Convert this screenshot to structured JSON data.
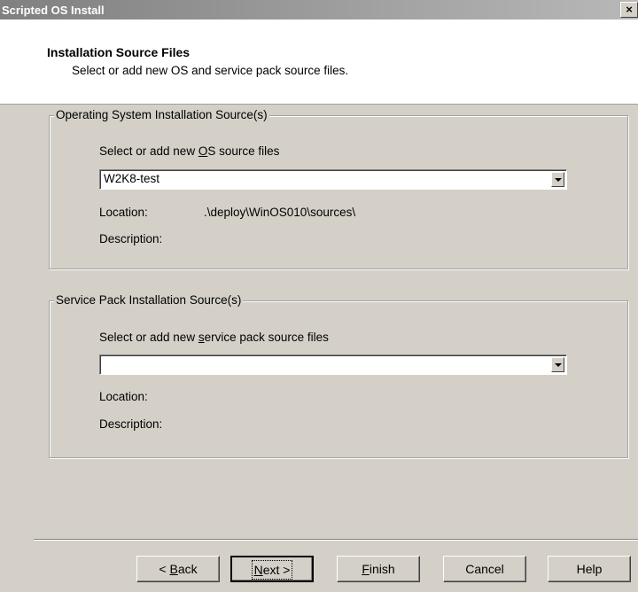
{
  "window": {
    "title": "Scripted OS Install",
    "close_glyph": "×"
  },
  "header": {
    "title": "Installation Source Files",
    "subtitle": "Select or add new OS and service pack source files."
  },
  "os_group": {
    "legend": "Operating System Installation Source(s)",
    "select_label_pre": "Select or add new ",
    "select_label_accel": "O",
    "select_label_post": "S source files",
    "selected_value": "W2K8-test",
    "location_label": "Location:",
    "location_value": ".\\deploy\\WinOS010\\sources\\",
    "description_label": "Description:",
    "description_value": ""
  },
  "sp_group": {
    "legend": "Service Pack Installation Source(s)",
    "select_label_pre": "Select or add new ",
    "select_label_accel": "s",
    "select_label_post": "ervice pack source files",
    "selected_value": "",
    "location_label": "Location:",
    "location_value": "",
    "description_label": "Description:",
    "description_value": ""
  },
  "buttons": {
    "back_pre": "< ",
    "back_accel": "B",
    "back_post": "ack",
    "next_accel": "N",
    "next_post": "ext >",
    "finish_accel": "F",
    "finish_post": "inish",
    "cancel": "Cancel",
    "help": "Help"
  }
}
